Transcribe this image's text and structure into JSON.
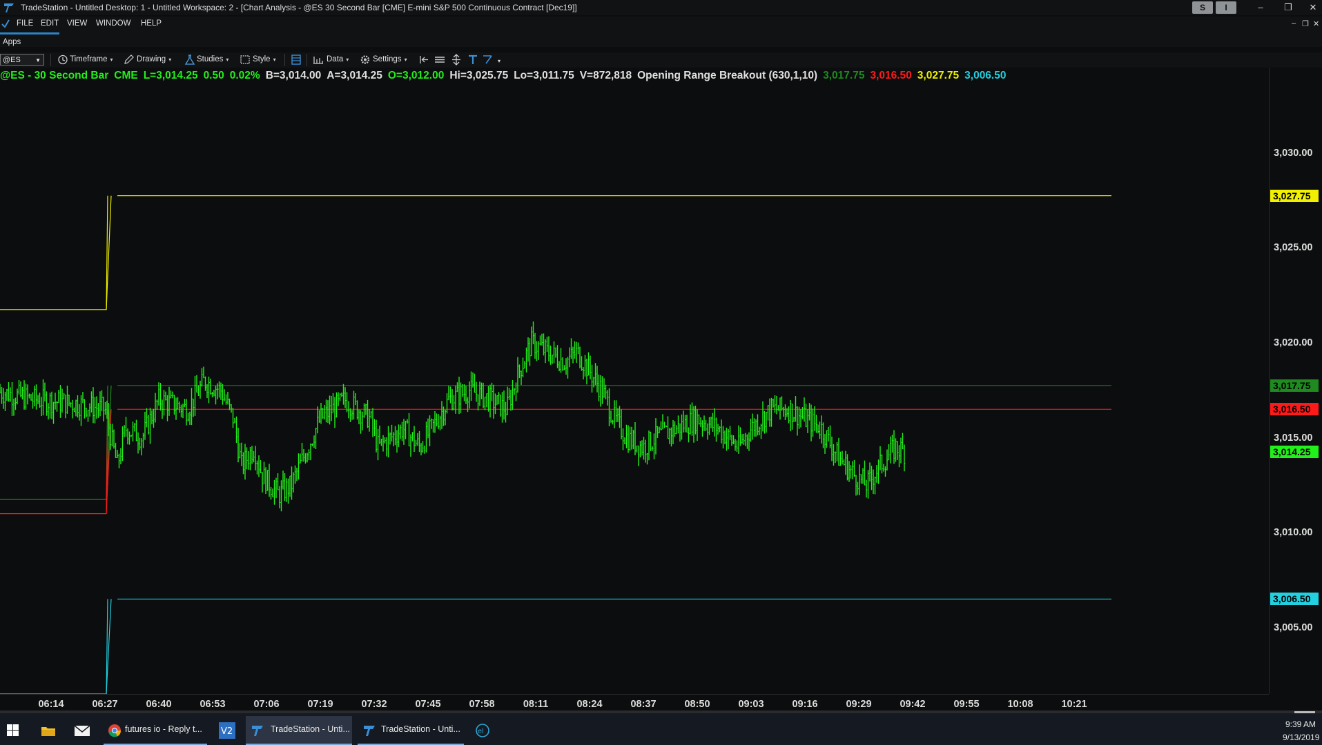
{
  "window": {
    "title": "TradeStation  - Untitled Desktop: 1 - Untitled Workspace:  2 - [Chart Analysis - @ES 30 Second Bar [CME] E-mini S&P 500 Continuous Contract [Dec19]]",
    "badge_s": "S",
    "badge_i": "I",
    "minimize": "–",
    "restore": "❐",
    "close": "✕",
    "inner_minimize": "–",
    "inner_restore": "❐",
    "inner_close": "✕"
  },
  "menu": [
    "FILE",
    "EDIT",
    "VIEW",
    "WINDOW",
    "HELP"
  ],
  "apps_label": "Apps",
  "toolbar": {
    "symbol": "@ES",
    "items": [
      "Timeframe",
      "Drawing",
      "Studies",
      "Style",
      "Data",
      "Settings"
    ]
  },
  "status": {
    "symbol": "@ES - 30 Second Bar",
    "exchange": "CME",
    "last": "L=3,014.25",
    "change": "0.50",
    "pct": "0.02%",
    "bid": "B=3,014.00",
    "ask": "A=3,014.25",
    "open": "O=3,012.00",
    "high": "Hi=3,025.75",
    "low": "Lo=3,011.75",
    "volume": "V=872,818",
    "study": "Opening Range Breakout (630,1,10)",
    "v1": "3,017.75",
    "v2": "3,016.50",
    "v3": "3,027.75",
    "v4": "3,006.50"
  },
  "colors": {
    "price_bars": "#22f01a",
    "upper_target": "#f0f000",
    "range_high": "#1f8a1f",
    "range_low": "#ff1a1a",
    "lower_target": "#22d0e0"
  },
  "chart_data": {
    "type": "bar",
    "title": "@ES - 30 Second Bar",
    "x_ticks": [
      "06:14",
      "06:27",
      "06:40",
      "06:53",
      "07:06",
      "07:19",
      "07:32",
      "07:45",
      "07:58",
      "08:11",
      "08:24",
      "08:37",
      "08:50",
      "09:03",
      "09:16",
      "09:29",
      "09:42",
      "09:55",
      "10:08",
      "10:21"
    ],
    "y_ticks": [
      "3,030.00",
      "3,025.00",
      "3,020.00",
      "3,015.00",
      "3,010.00",
      "3,005.00"
    ],
    "ylim": [
      3001.5,
      3034.5
    ],
    "price_path": [
      [
        "06:00",
        3017.5
      ],
      [
        "06:10",
        3017.0
      ],
      [
        "06:20",
        3016.8
      ],
      [
        "06:27",
        3016.5
      ],
      [
        "06:30",
        3013.5
      ],
      [
        "06:32",
        3015.5
      ],
      [
        "06:36",
        3015.0
      ],
      [
        "06:40",
        3017.0
      ],
      [
        "06:47",
        3016.5
      ],
      [
        "06:51",
        3018.0
      ],
      [
        "06:55",
        3017.5
      ],
      [
        "06:58",
        3016.0
      ],
      [
        "07:00",
        3013.5
      ],
      [
        "07:03",
        3014.5
      ],
      [
        "07:05",
        3013.0
      ],
      [
        "07:09",
        3012.0
      ],
      [
        "07:12",
        3012.5
      ],
      [
        "07:16",
        3014.5
      ],
      [
        "07:19",
        3016.0
      ],
      [
        "07:22",
        3016.5
      ],
      [
        "07:25",
        3017.0
      ],
      [
        "07:28",
        3016.5
      ],
      [
        "07:31",
        3016.0
      ],
      [
        "07:33",
        3014.5
      ],
      [
        "07:36",
        3015.0
      ],
      [
        "07:39",
        3015.5
      ],
      [
        "07:43",
        3014.5
      ],
      [
        "07:46",
        3015.5
      ],
      [
        "07:50",
        3017.0
      ],
      [
        "07:55",
        3017.5
      ],
      [
        "08:00",
        3017.0
      ],
      [
        "08:04",
        3016.5
      ],
      [
        "08:07",
        3018.5
      ],
      [
        "08:10",
        3020.0
      ],
      [
        "08:14",
        3019.5
      ],
      [
        "08:18",
        3019.0
      ],
      [
        "08:21",
        3019.5
      ],
      [
        "08:24",
        3018.5
      ],
      [
        "08:27",
        3017.5
      ],
      [
        "08:30",
        3016.0
      ],
      [
        "08:33",
        3015.0
      ],
      [
        "08:37",
        3014.5
      ],
      [
        "08:40",
        3015.0
      ],
      [
        "08:45",
        3015.5
      ],
      [
        "08:50",
        3016.0
      ],
      [
        "08:55",
        3015.5
      ],
      [
        "09:00",
        3014.5
      ],
      [
        "09:03",
        3015.5
      ],
      [
        "09:08",
        3016.5
      ],
      [
        "09:12",
        3016.5
      ],
      [
        "09:16",
        3016.0
      ],
      [
        "09:20",
        3015.5
      ],
      [
        "09:24",
        3014.0
      ],
      [
        "09:28",
        3013.0
      ],
      [
        "09:31",
        3012.5
      ],
      [
        "09:34",
        3013.5
      ],
      [
        "09:38",
        3014.5
      ],
      [
        "09:40",
        3014.25
      ]
    ],
    "levels": [
      {
        "name": "3,027.75",
        "value": 3027.75,
        "pre_open_value": 3021.75,
        "color": "#f0f000"
      },
      {
        "name": "3,017.75",
        "value": 3017.75,
        "pre_open_value": 3011.75,
        "color": "#1f8a1f"
      },
      {
        "name": "3,016.50",
        "value": 3016.5,
        "pre_open_value": 3011.0,
        "color": "#ff1a1a"
      },
      {
        "name": "3,006.50",
        "value": 3006.5,
        "pre_open_value": 3001.5,
        "color": "#22d0e0"
      }
    ],
    "last_price": "3,014.25",
    "grid": false
  },
  "taskbar": {
    "items": [
      {
        "label": "futures io - Reply t...",
        "icon": "chrome-icon"
      },
      {
        "label": "TradeStation  - Unti...",
        "icon": "tradestation-icon"
      },
      {
        "label": "TradeStation  - Unti...",
        "icon": "tradestation-icon"
      }
    ],
    "time": "9:39 AM",
    "date": "9/13/2019"
  }
}
